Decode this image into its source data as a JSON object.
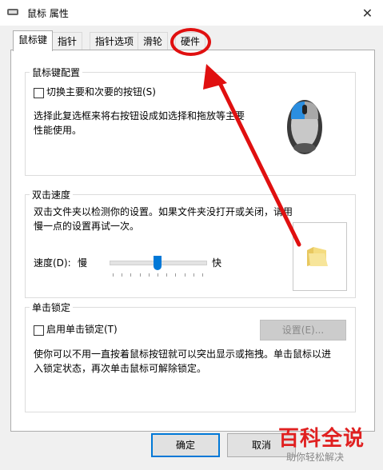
{
  "window": {
    "title": "鼠标 属性",
    "close_glyph": "✕"
  },
  "tabs": [
    {
      "label": "鼠标键",
      "active": true
    },
    {
      "label": "指针",
      "active": false
    },
    {
      "label": "指针选项",
      "active": false
    },
    {
      "label": "滑轮",
      "active": false
    },
    {
      "label": "硬件",
      "active": false
    }
  ],
  "button_config": {
    "title": "鼠标键配置",
    "swap_checkbox_label": "切换主要和次要的按钮(S)",
    "swap_checked": false,
    "description": "选择此复选框来将右按钮设成如选择和拖放等主要性能使用。",
    "image": "mouse-icon"
  },
  "double_click": {
    "title": "双击速度",
    "description": "双击文件夹以检测你的设置。如果文件夹没打开或关闭，请用慢一点的设置再试一次。",
    "speed_label": "速度(D):",
    "slow_label": "慢",
    "fast_label": "快",
    "speed_value": 0.5,
    "image": "folder-icon"
  },
  "click_lock": {
    "title": "单击锁定",
    "checkbox_label": "启用单击锁定(T)",
    "checked": false,
    "settings_button": "设置(E)...",
    "description": "使你可以不用一直按着鼠标按钮就可以突出显示或拖拽。单击鼠标以进入锁定状态，再次单击鼠标可解除锁定。"
  },
  "footer": {
    "ok_button": "确定",
    "cancel_button": "取消"
  },
  "watermark": {
    "brand": "百科全说",
    "slogan": "助你轻松解决"
  },
  "colors": {
    "accent": "#0078d7",
    "annotation_red": "#e01010"
  }
}
